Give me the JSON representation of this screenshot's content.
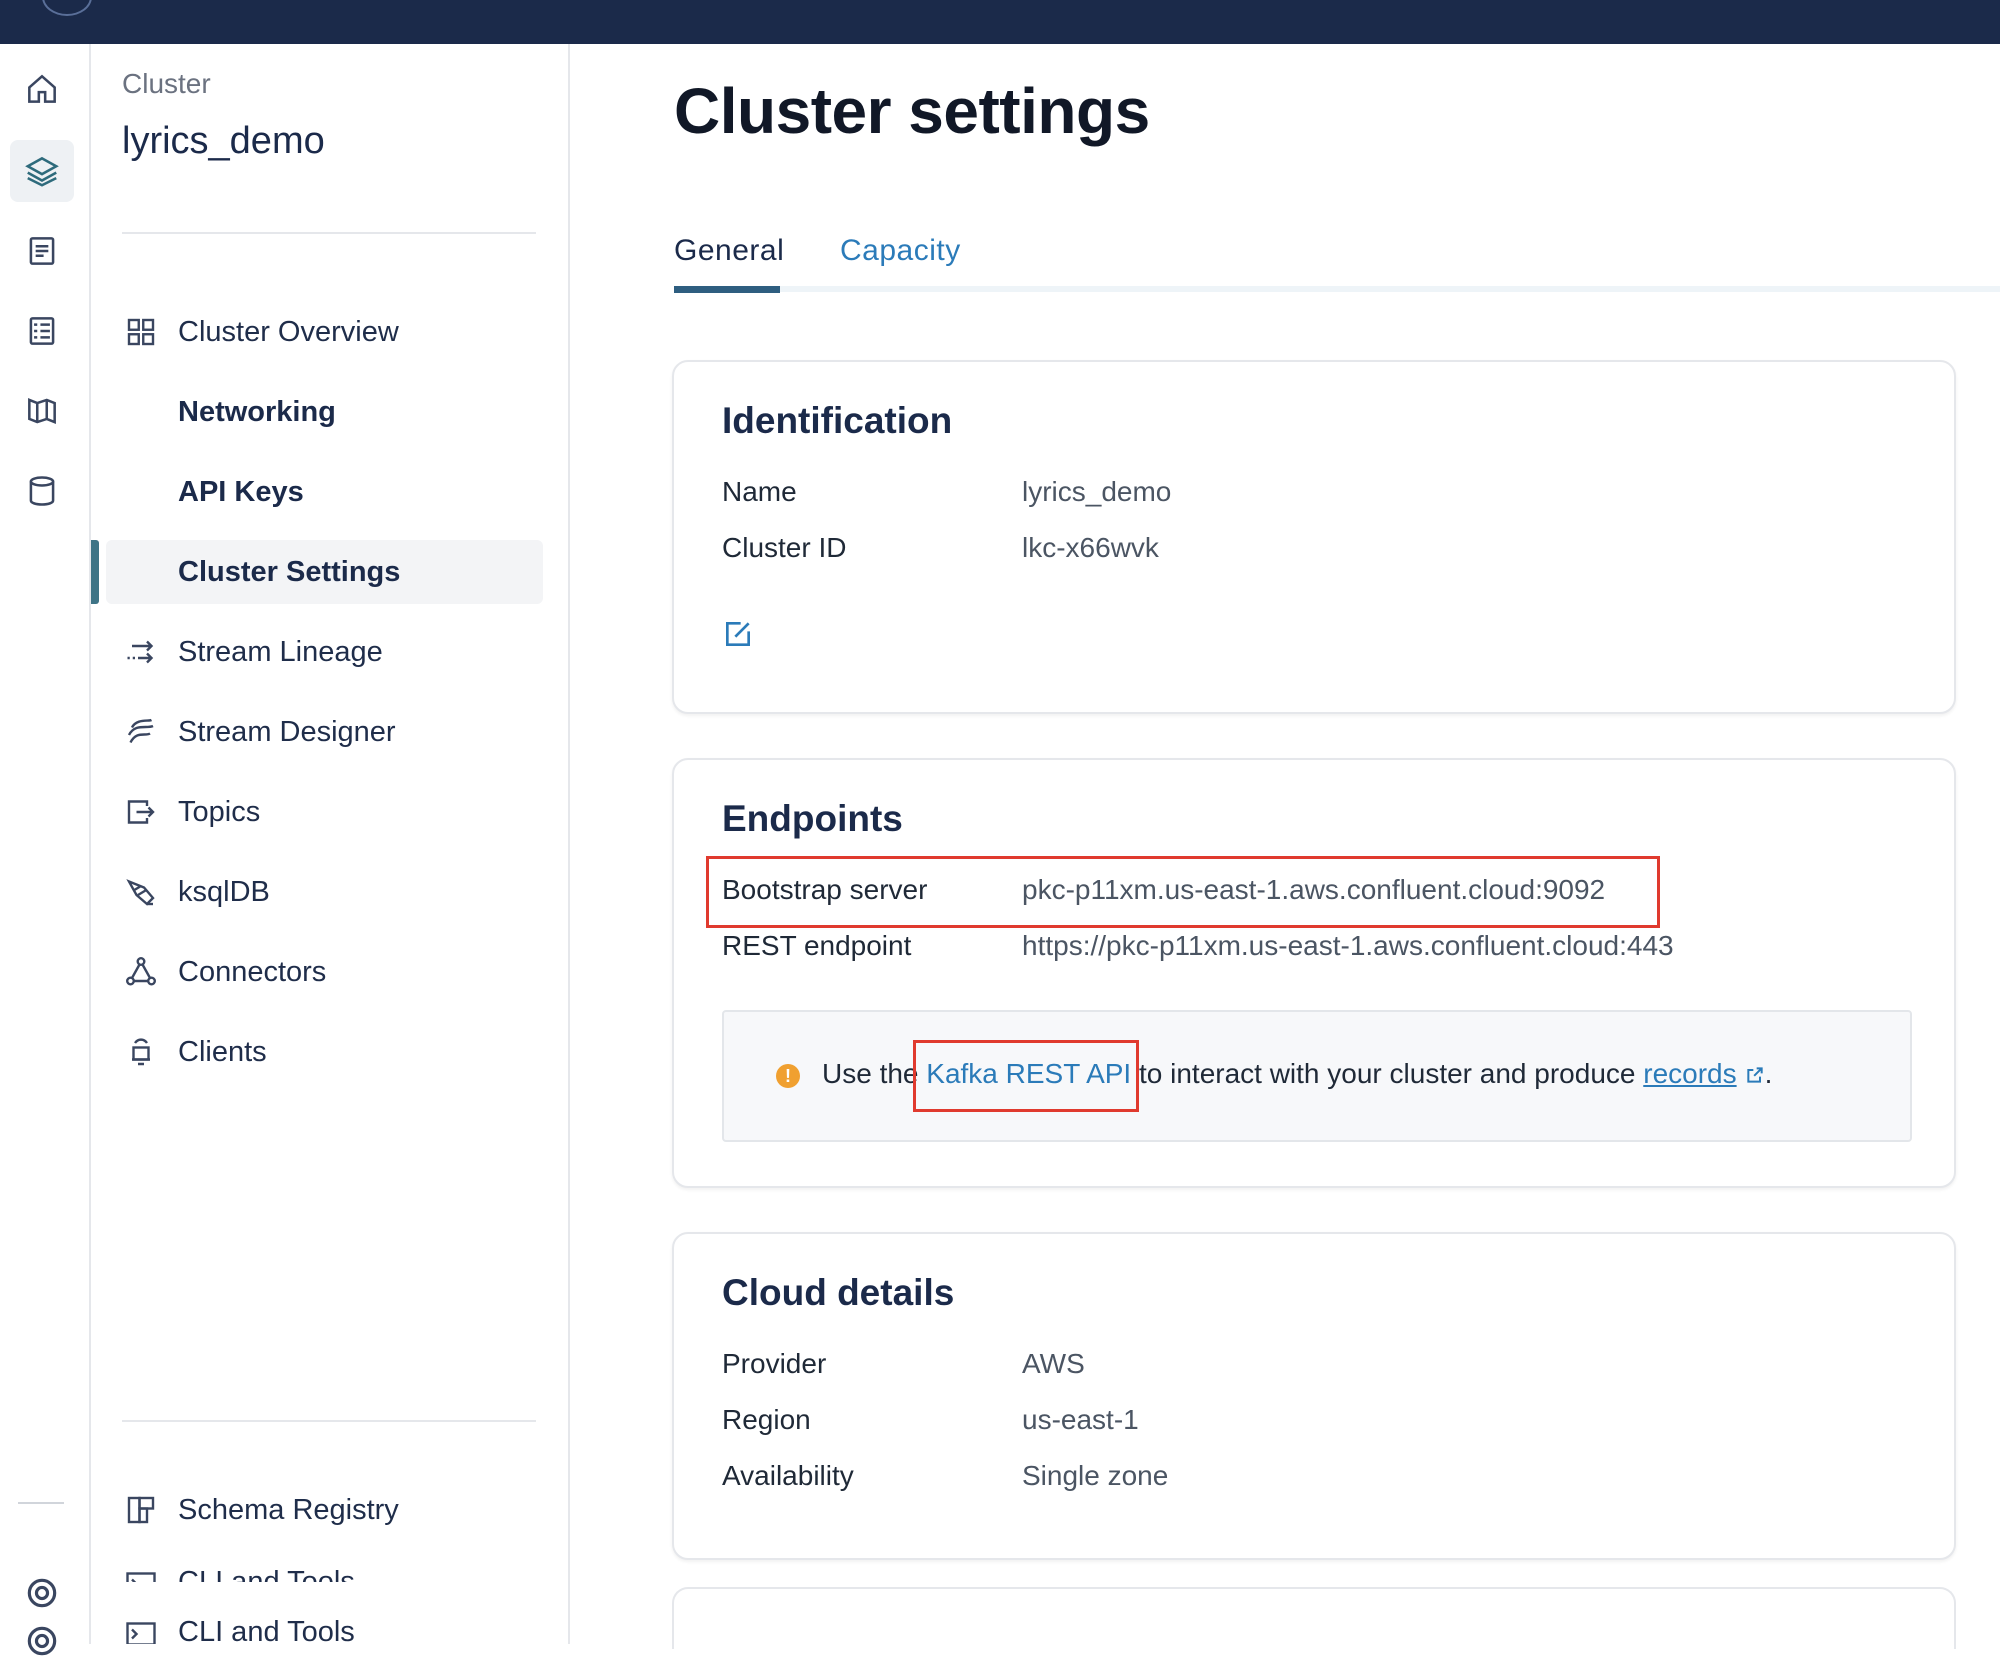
{
  "rail": {
    "icons": [
      "home-icon",
      "layers-icon",
      "document-icon",
      "list-icon",
      "map-icon",
      "database-icon",
      "help-icon",
      "help-icon"
    ]
  },
  "sidenav": {
    "crumb": "Cluster",
    "cluster_name": "lyrics_demo",
    "items": [
      {
        "label": "Cluster Overview",
        "icon": "grid-icon"
      },
      {
        "label": "Networking"
      },
      {
        "label": "API Keys"
      },
      {
        "label": "Cluster Settings"
      },
      {
        "label": "Stream Lineage",
        "icon": "lineage-icon"
      },
      {
        "label": "Stream Designer",
        "icon": "designer-icon"
      },
      {
        "label": "Topics",
        "icon": "topics-icon"
      },
      {
        "label": "ksqlDB",
        "icon": "ksqldb-icon"
      },
      {
        "label": "Connectors",
        "icon": "connectors-icon"
      },
      {
        "label": "Clients",
        "icon": "clients-icon"
      }
    ],
    "bottom_items": [
      {
        "label": "Schema Registry",
        "icon": "schema-icon"
      },
      {
        "label": "CLI and Tools",
        "icon": "terminal-icon"
      },
      {
        "label": "CLI and Tools",
        "icon": "terminal-icon"
      }
    ]
  },
  "page": {
    "title": "Cluster settings",
    "tabs": [
      {
        "label": "General",
        "active": true
      },
      {
        "label": "Capacity",
        "active": false
      }
    ]
  },
  "identification": {
    "title": "Identification",
    "rows": [
      {
        "key": "Name",
        "value": "lyrics_demo"
      },
      {
        "key": "Cluster ID",
        "value": "lkc-x66wvk"
      }
    ]
  },
  "endpoints": {
    "title": "Endpoints",
    "rows": [
      {
        "key": "Bootstrap server",
        "value": "pkc-p11xm.us-east-1.aws.confluent.cloud:9092"
      },
      {
        "key": "REST endpoint",
        "value": "https://pkc-p11xm.us-east-1.aws.confluent.cloud:443"
      }
    ],
    "note": {
      "prefix": "Use the",
      "link": "Kafka REST API",
      "middle": "to interact with your cluster and produce",
      "link2": "records",
      "suffix": "."
    }
  },
  "cloud": {
    "title": "Cloud details",
    "rows": [
      {
        "key": "Provider",
        "value": "AWS"
      },
      {
        "key": "Region",
        "value": "us-east-1"
      },
      {
        "key": "Availability",
        "value": "Single zone"
      }
    ]
  },
  "colors": {
    "topbar": "#1b2a4a",
    "accent": "#2b7bb9",
    "active_bar": "#3e7486",
    "highlight": "#e03a2e",
    "warn": "#f0a030"
  }
}
